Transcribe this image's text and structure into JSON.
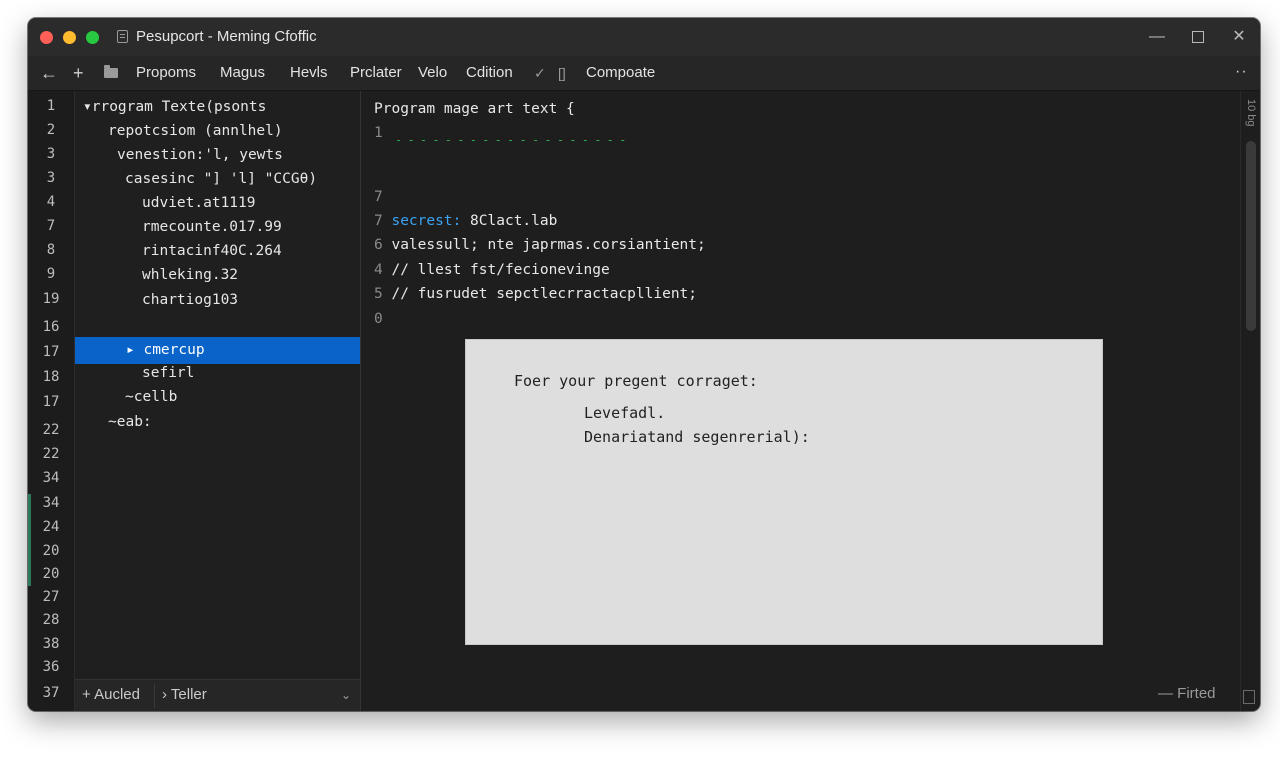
{
  "window": {
    "title": "Pesupcort - Meming Cfoffic",
    "controls": {
      "minimize": "—",
      "close": "✕"
    }
  },
  "toolbar": {
    "menu": [
      "Propoms",
      "Magus",
      "Hevls",
      "Prclater",
      "Velo",
      "Cdition",
      "Compoate"
    ],
    "back_glyph": "←",
    "add_glyph": "+",
    "check_glyph": "✓",
    "clip_glyph": "[]",
    "more_glyph": "··"
  },
  "gutter": {
    "line_numbers": [
      "1",
      "2",
      "3",
      "3",
      "4",
      "7",
      "8",
      "9",
      "19",
      "16",
      "17",
      "18",
      "17",
      "22",
      "22",
      "34",
      "34",
      "24",
      "20",
      "20",
      "27",
      "28",
      "38",
      "36",
      "37"
    ]
  },
  "tree": {
    "items": [
      "▾rrogram Texte(psonts",
      "repotcsiom (annlhel)",
      "venestion:'l, yewts",
      "casesinc \"] 'l] \"CCGθ)",
      "udviet.at1119",
      "rmecounte.017.99",
      "rintacinf40C.264",
      "whleking.32",
      "chartiog103",
      "▸ cmercup",
      "sefirl",
      "~cellb",
      "~eab:"
    ],
    "selected_index": 9,
    "footer": {
      "left": "+ Aucled",
      "right": "› Teller",
      "chevron": "⌄"
    }
  },
  "editor": {
    "header": "Program mage art text {",
    "dashes": "- - - - - - - - - - - - - - - - - - -",
    "lines": [
      {
        "num": "1",
        "keyword": "",
        "text": ""
      },
      {
        "num": "7",
        "keyword": "",
        "text": ""
      },
      {
        "num": "7",
        "keyword": "secrest:",
        "text": " 8Clact.lab"
      },
      {
        "num": "6",
        "keyword": "",
        "text": " valessull; nte japrmas.corsiantient;"
      },
      {
        "num": "4",
        "keyword": "",
        "text": " // llest fst/fecionevinge"
      },
      {
        "num": "5",
        "keyword": "",
        "text": " // fusrudet sepctlecrractacpllient;"
      },
      {
        "num": "0",
        "keyword": "",
        "text": ""
      }
    ]
  },
  "dialog": {
    "title": "Foer your pregent corraget:",
    "lines": [
      "Levefadl.",
      "Denariatand segenrerial):"
    ]
  },
  "rail": {
    "label": "10 bg"
  },
  "status": {
    "text": "— Firted"
  },
  "colors": {
    "selection": "#0a63c9",
    "keyword": "#3aa3f2",
    "dashes": "#2fa84f",
    "dialog_bg": "#dedede"
  }
}
